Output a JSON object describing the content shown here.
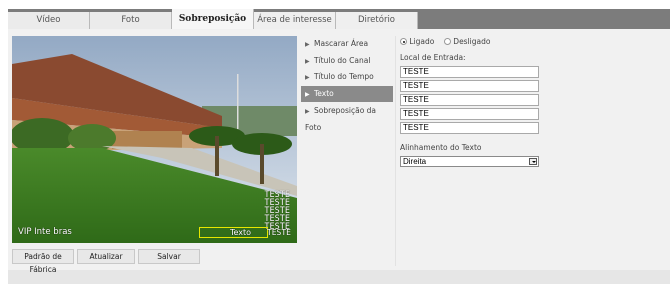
{
  "tabs": [
    "Vídeo",
    "Foto",
    "Sobreposição",
    "Área de interesse",
    "Diretório"
  ],
  "active_tab": "Sobreposição",
  "video": {
    "overlay_brand": "VIP Inte bras",
    "overlay_lines": [
      "TESTE",
      "TESTE",
      "TESTE",
      "TESTE",
      "TESTE"
    ],
    "mask_label": "Texto",
    "mask_label_value": "TESTE"
  },
  "buttons": {
    "factory_default": "Padrão de Fábrica",
    "refresh": "Atualizar",
    "save": "Salvar"
  },
  "menu": {
    "items": [
      "Mascarar Área",
      "Título do Canal",
      "Título do Tempo",
      "Texto",
      "Sobreposição da Foto"
    ],
    "active": "Texto",
    "arrow_glyph": "▶"
  },
  "form": {
    "on_label": "Ligado",
    "off_label": "Desligado",
    "selected": "Ligado",
    "entry_label": "Local de Entrada:",
    "entries": [
      "TESTE",
      "TESTE",
      "TESTE",
      "TESTE",
      "TESTE"
    ],
    "align_label": "Alinhamento do Texto",
    "align_value": "Direita"
  }
}
